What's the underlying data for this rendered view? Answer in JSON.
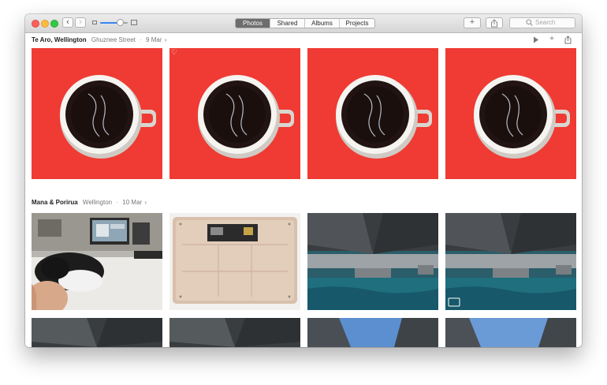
{
  "toolbar": {
    "tabs": [
      {
        "label": "Photos",
        "active": true
      },
      {
        "label": "Shared",
        "active": false
      },
      {
        "label": "Albums",
        "active": false
      },
      {
        "label": "Projects",
        "active": false
      }
    ],
    "search_placeholder": "Search",
    "zoom_level": 0.72
  },
  "moments": [
    {
      "title": "Te Aro, Wellington",
      "subtitle": "Ghuznee Street",
      "date": "9 Mar",
      "chevron": "›"
    },
    {
      "title": "Mana & Porirua",
      "subtitle": "Wellington",
      "date": "10 Mar",
      "chevron": "›"
    }
  ],
  "separator": "·",
  "icons": {
    "back": "chevron-left-icon",
    "forward": "chevron-right-icon",
    "add": "plus-icon",
    "share": "share-icon",
    "search": "magnifier-icon",
    "play": "play-icon",
    "favorite": "heart-icon"
  },
  "colors": {
    "accent": "#3b85f2",
    "tab_active": "#6d6d6d",
    "coffee_background": "#ef3b33"
  }
}
